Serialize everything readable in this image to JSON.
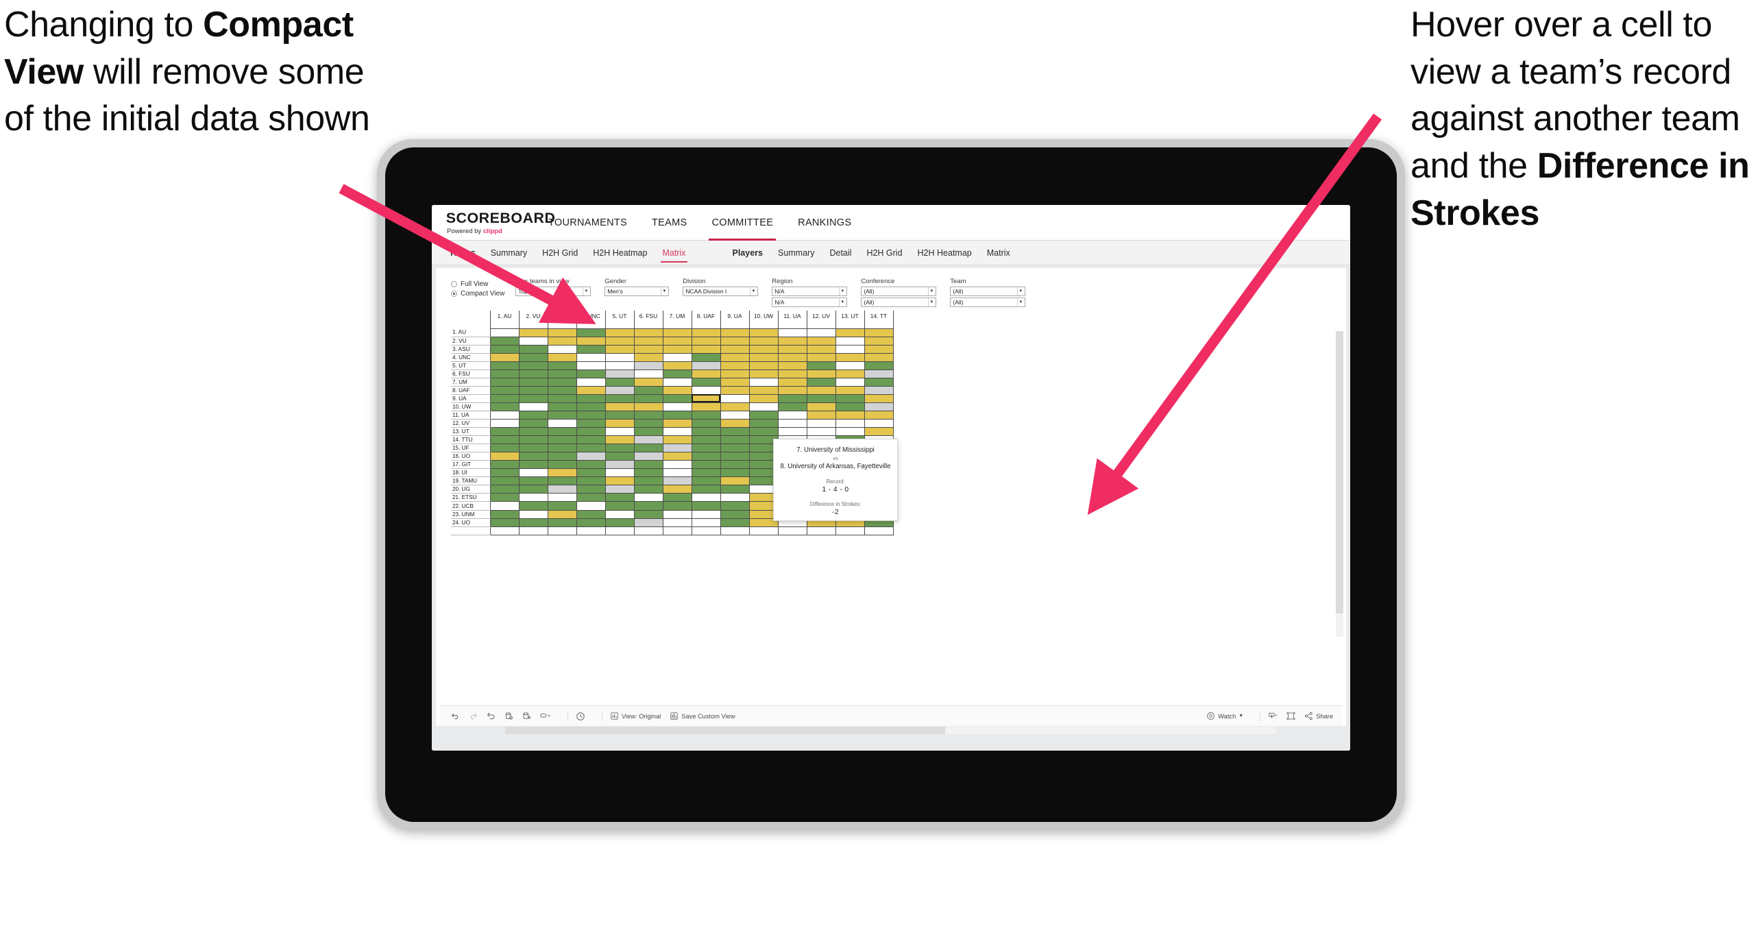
{
  "annotations": {
    "left": {
      "part1": "Changing to ",
      "bold": "Compact View",
      "part2": " will remove some of the initial data shown"
    },
    "right": {
      "part1": "Hover over a cell to view a team’s record against another team and the ",
      "bold": "Difference in Strokes",
      "part2": ""
    },
    "arrow_color": "#ef2d63"
  },
  "app": {
    "brand": {
      "name": "SCOREBOARD",
      "powered_prefix": "Powered by ",
      "powered_brand": "clippd"
    },
    "topnav": [
      {
        "label": "TOURNAMENTS",
        "active": false
      },
      {
        "label": "TEAMS",
        "active": false
      },
      {
        "label": "COMMITTEE",
        "active": true
      },
      {
        "label": "RANKINGS",
        "active": false
      }
    ],
    "subnav": [
      {
        "head": "Teams",
        "items": [
          "Summary",
          "H2H Grid",
          "H2H Heatmap",
          "Matrix"
        ],
        "selected": "Matrix"
      },
      {
        "head": "Players",
        "items": [
          "Summary",
          "Detail",
          "H2H Grid",
          "H2H Heatmap",
          "Matrix"
        ],
        "selected": ""
      }
    ]
  },
  "filters": {
    "view_mode": {
      "full_label": "Full View",
      "compact_label": "Compact View",
      "selected": "Compact View"
    },
    "controls": [
      {
        "label": "Max teams in view",
        "value": "Top 50",
        "wide": false
      },
      {
        "label": "Gender",
        "value": "Men's",
        "wide": false
      },
      {
        "label": "Division",
        "value": "NCAA Division I",
        "wide": true
      },
      {
        "label": "Region",
        "value": "N/A",
        "value2": "N/A",
        "wide": false
      },
      {
        "label": "Conference",
        "value": "(All)",
        "value2": "(All)",
        "wide": false
      },
      {
        "label": "Team",
        "value": "(All)",
        "value2": "(All)",
        "wide": false
      }
    ]
  },
  "matrix": {
    "columns": [
      "1. AU",
      "2. VU",
      "3. ASU",
      "4. UNC",
      "5. UT",
      "6. FSU",
      "7. UM",
      "8. UAF",
      "9. UA",
      "10. UW",
      "11. UA",
      "12. UV",
      "13. UT",
      "14. TT"
    ],
    "rows": [
      "1. AU",
      "2. VU",
      "3. ASU",
      "4. UNC",
      "5. UT",
      "6. FSU",
      "7. UM",
      "8. UAF",
      "9. UA",
      "10. UW",
      "11. UA",
      "12. UV",
      "13. UT",
      "14. TTU",
      "15. UF",
      "16. UO",
      "17. GIT",
      "18. UI",
      "19. TAMU",
      "20. UG",
      "21. ETSU",
      "22. UCB",
      "23. UNM",
      "24. UO"
    ],
    "legend": {
      "G": "win",
      "Y": "loss",
      "W": "no-data",
      "A": "tie"
    },
    "colors": {
      "green": "#6b9c53",
      "yellow": "#e4c64e",
      "white": "#ffffff",
      "grey": "#d2d3d4"
    },
    "selected_cell": {
      "row": 8,
      "col": 7
    },
    "cells": [
      [
        "W",
        "Y",
        "Y",
        "G",
        "Y",
        "Y",
        "Y",
        "Y",
        "Y",
        "Y",
        "W",
        "W",
        "Y",
        "Y"
      ],
      [
        "G",
        "W",
        "Y",
        "Y",
        "Y",
        "Y",
        "Y",
        "Y",
        "Y",
        "Y",
        "Y",
        "Y",
        "W",
        "Y"
      ],
      [
        "G",
        "G",
        "W",
        "G",
        "Y",
        "Y",
        "Y",
        "Y",
        "Y",
        "Y",
        "Y",
        "Y",
        "W",
        "Y"
      ],
      [
        "Y",
        "G",
        "Y",
        "W",
        "W",
        "Y",
        "W",
        "G",
        "Y",
        "Y",
        "Y",
        "Y",
        "Y",
        "Y"
      ],
      [
        "G",
        "G",
        "G",
        "W",
        "W",
        "A",
        "Y",
        "A",
        "Y",
        "Y",
        "Y",
        "G",
        "W",
        "G"
      ],
      [
        "G",
        "G",
        "G",
        "G",
        "A",
        "W",
        "G",
        "Y",
        "Y",
        "Y",
        "Y",
        "Y",
        "Y",
        "A"
      ],
      [
        "G",
        "G",
        "G",
        "W",
        "G",
        "Y",
        "W",
        "G",
        "Y",
        "W",
        "Y",
        "G",
        "W",
        "G"
      ],
      [
        "G",
        "G",
        "G",
        "Y",
        "A",
        "G",
        "Y",
        "W",
        "Y",
        "Y",
        "Y",
        "Y",
        "Y",
        "A"
      ],
      [
        "G",
        "G",
        "G",
        "G",
        "G",
        "G",
        "G",
        "Y",
        "W",
        "Y",
        "G",
        "G",
        "G",
        "Y"
      ],
      [
        "G",
        "W",
        "G",
        "G",
        "Y",
        "Y",
        "W",
        "Y",
        "Y",
        "W",
        "G",
        "Y",
        "G",
        "A"
      ],
      [
        "W",
        "G",
        "G",
        "G",
        "G",
        "G",
        "G",
        "G",
        "W",
        "G",
        "W",
        "Y",
        "Y",
        "Y"
      ],
      [
        "W",
        "G",
        "W",
        "G",
        "Y",
        "G",
        "Y",
        "G",
        "Y",
        "G",
        "W",
        "W",
        "W",
        "W"
      ],
      [
        "G",
        "G",
        "G",
        "G",
        "W",
        "G",
        "W",
        "G",
        "G",
        "G",
        "W",
        "W",
        "W",
        "Y"
      ],
      [
        "G",
        "G",
        "G",
        "G",
        "Y",
        "A",
        "Y",
        "G",
        "G",
        "G",
        "W",
        "W",
        "G",
        "W"
      ],
      [
        "G",
        "G",
        "G",
        "G",
        "G",
        "G",
        "A",
        "G",
        "G",
        "G",
        "W",
        "W",
        "W",
        "W"
      ],
      [
        "Y",
        "G",
        "G",
        "A",
        "G",
        "A",
        "Y",
        "G",
        "G",
        "G",
        "W",
        "G",
        "Y",
        "Y"
      ],
      [
        "G",
        "G",
        "G",
        "G",
        "A",
        "G",
        "W",
        "G",
        "G",
        "G",
        "W",
        "A",
        "Y",
        "A"
      ],
      [
        "G",
        "W",
        "Y",
        "G",
        "W",
        "G",
        "W",
        "G",
        "G",
        "G",
        "W",
        "G",
        "Y",
        "Y"
      ],
      [
        "G",
        "G",
        "G",
        "G",
        "Y",
        "G",
        "A",
        "G",
        "Y",
        "G",
        "G",
        "G",
        "A",
        "Y"
      ],
      [
        "G",
        "G",
        "A",
        "G",
        "A",
        "G",
        "Y",
        "G",
        "G",
        "W",
        "W",
        "G",
        "A",
        "Y"
      ],
      [
        "G",
        "W",
        "W",
        "G",
        "G",
        "W",
        "G",
        "W",
        "W",
        "Y",
        "G",
        "G",
        "W",
        "Y"
      ],
      [
        "W",
        "G",
        "G",
        "W",
        "G",
        "G",
        "G",
        "G",
        "G",
        "Y",
        "W",
        "G",
        "G",
        "G"
      ],
      [
        "G",
        "W",
        "Y",
        "G",
        "W",
        "G",
        "W",
        "W",
        "G",
        "Y",
        "G",
        "G",
        "G",
        "Y"
      ],
      [
        "G",
        "G",
        "G",
        "G",
        "G",
        "A",
        "W",
        "W",
        "G",
        "Y",
        "W",
        "Y",
        "Y",
        "G"
      ]
    ]
  },
  "tooltip": {
    "team_a": "7. University of Mississippi",
    "vs": "vs",
    "team_b": "8. University of Arkansas, Fayetteville",
    "record_label": "Record:",
    "record_value": "1 - 4 - 0",
    "diff_label": "Difference in Strokes:",
    "diff_value": "-2"
  },
  "toolbar": {
    "view_original": "View: Original",
    "save_custom": "Save Custom View",
    "watch": "Watch",
    "share": "Share"
  }
}
